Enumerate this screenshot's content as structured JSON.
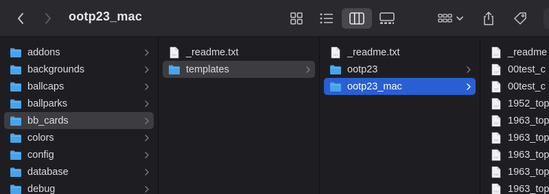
{
  "window": {
    "title": "ootp23_mac"
  },
  "toolbar": {
    "back_icon": "chevron-left-icon",
    "forward_icon": "chevron-right-icon",
    "view_buttons": [
      "icon-view",
      "list-view",
      "column-view",
      "gallery-view"
    ],
    "active_view": "column-view",
    "group_icon": "group-by-icon",
    "share_icon": "share-icon",
    "tag_icon": "tag-icon"
  },
  "columns": [
    {
      "items": [
        {
          "label": "addons",
          "kind": "folder",
          "has_children": true
        },
        {
          "label": "backgrounds",
          "kind": "folder",
          "has_children": true
        },
        {
          "label": "ballcaps",
          "kind": "folder",
          "has_children": true
        },
        {
          "label": "ballparks",
          "kind": "folder",
          "has_children": true
        },
        {
          "label": "bb_cards",
          "kind": "folder",
          "has_children": true,
          "state": "hover"
        },
        {
          "label": "colors",
          "kind": "folder",
          "has_children": true
        },
        {
          "label": "config",
          "kind": "folder",
          "has_children": true
        },
        {
          "label": "database",
          "kind": "folder",
          "has_children": true
        },
        {
          "label": "debug",
          "kind": "folder",
          "has_children": true
        }
      ]
    },
    {
      "items": [
        {
          "label": "_readme.txt",
          "kind": "file",
          "has_children": false
        },
        {
          "label": "templates",
          "kind": "folder",
          "has_children": true,
          "state": "hover"
        }
      ]
    },
    {
      "items": [
        {
          "label": "_readme.txt",
          "kind": "file",
          "has_children": false
        },
        {
          "label": "ootp23",
          "kind": "folder",
          "has_children": true
        },
        {
          "label": "ootp23_mac",
          "kind": "folder",
          "has_children": true,
          "state": "selected"
        }
      ]
    },
    {
      "items": [
        {
          "label": "_readme",
          "kind": "file",
          "has_children": false
        },
        {
          "label": "00test_c",
          "kind": "file",
          "has_children": false
        },
        {
          "label": "00test_c",
          "kind": "file",
          "has_children": false
        },
        {
          "label": "1952_top",
          "kind": "file",
          "has_children": false
        },
        {
          "label": "1963_top",
          "kind": "file",
          "has_children": false
        },
        {
          "label": "1963_top",
          "kind": "file",
          "has_children": false
        },
        {
          "label": "1963_top",
          "kind": "file",
          "has_children": false
        },
        {
          "label": "1963_top",
          "kind": "file",
          "has_children": false
        },
        {
          "label": "1963_top",
          "kind": "file",
          "has_children": false
        }
      ]
    }
  ],
  "colors": {
    "folder": "#4aa3e8",
    "selection": "#2a5fd3",
    "hover": "#3d3d41"
  },
  "file_icon_text": "TXT"
}
